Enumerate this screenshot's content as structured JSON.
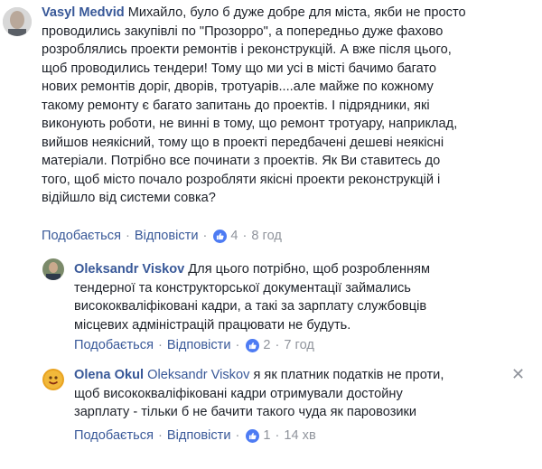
{
  "comments": [
    {
      "author": "Vasyl Medvid",
      "lines": [
        "Михайло, було б дуже добре для міста, якби не просто",
        "проводились закупівлі по \"Прозорро\", а попередньо дуже фахово",
        "розроблялись проекти ремонтів і реконструкцій. А вже після цього,",
        "щоб проводились тендери! Тому що ми усі в місті бачимо багато",
        "нових ремонтів доріг, дворів, тротуарів....але майже по кожному",
        "такому ремонту є багато запитань до проектів. І підрядники, які",
        "виконують роботи, не винні в тому, що ремонт тротуару, наприклад,",
        "вийшов неякісний, тому що в проекті передбачені дешеві неякісні",
        "матеріали. Потрібно все починати з проектів. Як Ви ставитесь до",
        "того, щоб місто почало розробляти якісні проекти реконструкцій і",
        "відійшло від системи совка?"
      ],
      "like_label": "Подобається",
      "reply_label": "Відповісти",
      "like_count": "4",
      "time": "8 год"
    },
    {
      "author": "Oleksandr Viskov",
      "lines": [
        "Для цього потрібно, щоб розробленням",
        "тендерної та конструкторської документації займались",
        "висококваліфіковані кадри, а такі за зарплату службовців",
        "місцевих адміністрацій працювати не будуть."
      ],
      "like_label": "Подобається",
      "reply_label": "Відповісти",
      "like_count": "2",
      "time": "7 год"
    },
    {
      "author": "Olena Okul",
      "mention": "Oleksandr Viskov",
      "lines": [
        "я як платник податків не проти,",
        "щоб висококваліфіковані кадри отримували достойну",
        "зарплату - тільки б не бачити такого чуда як паровозики"
      ],
      "like_label": "Подобається",
      "reply_label": "Відповісти",
      "like_count": "1",
      "time": "14 хв"
    }
  ],
  "separator": "·",
  "close_glyph": "✕",
  "colors": {
    "link": "#385898",
    "text": "#1d2129",
    "meta": "#90949c",
    "like_badge": "#4d7bf3"
  }
}
